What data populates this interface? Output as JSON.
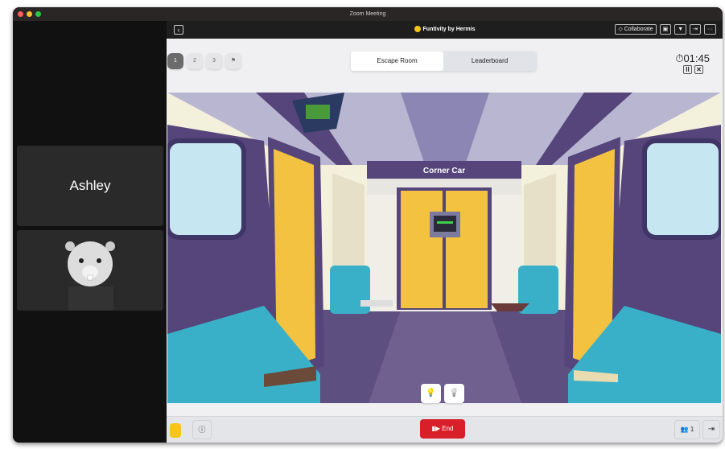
{
  "window": {
    "title": "Zoom Meeting"
  },
  "participants": [
    {
      "name": "Ashley"
    },
    {
      "name": "",
      "avatar": "beaver-avatar"
    }
  ],
  "app": {
    "title": "Funtivity by Hermis",
    "collaborate_label": "Collaborate",
    "steps": [
      "1",
      "2",
      "3"
    ],
    "tabs": [
      {
        "label": "Escape Room",
        "active": true
      },
      {
        "label": "Leaderboard",
        "active": false
      }
    ],
    "timer": "01:45",
    "scene": {
      "title": "Corner Car"
    },
    "end_label": "End",
    "participant_count": "1"
  }
}
